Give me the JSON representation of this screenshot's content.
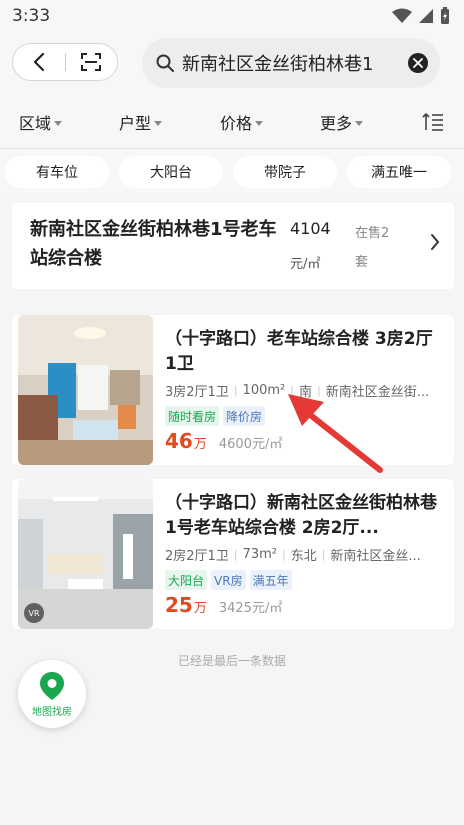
{
  "status_bar": {
    "time": "3:33"
  },
  "search": {
    "query": "新南社区金丝街柏林巷1"
  },
  "filters": [
    {
      "label": "区域"
    },
    {
      "label": "户型"
    },
    {
      "label": "价格"
    },
    {
      "label": "更多"
    }
  ],
  "tags": [
    "有车位",
    "大阳台",
    "带院子",
    "满五唯一"
  ],
  "community": {
    "name": "新南社区金丝街柏林巷1号老车站综合楼",
    "price_value": "4104",
    "price_unit": "元/㎡",
    "on_sale": "在售2套"
  },
  "listings": [
    {
      "title": "（十字路口）老车站综合楼 3房2厅1卫",
      "meta": [
        "3房2厅1卫",
        "100m²",
        "南",
        "新南社区金丝街..."
      ],
      "tags": [
        {
          "text": "随时看房",
          "style": "green"
        },
        {
          "text": "降价房",
          "style": "blue"
        }
      ],
      "price": "46",
      "price_unit": "万",
      "unit_price": "4600元/㎡"
    },
    {
      "title": "（十字路口）新南社区金丝街柏林巷1号老车站综合楼 2房2厅...",
      "meta": [
        "2房2厅1卫",
        "73m²",
        "东北",
        "新南社区金丝..."
      ],
      "tags": [
        {
          "text": "大阳台",
          "style": "green"
        },
        {
          "text": "VR房",
          "style": "blue"
        },
        {
          "text": "满五年",
          "style": "blue"
        }
      ],
      "price": "25",
      "price_unit": "万",
      "unit_price": "3425元/㎡",
      "vr_badge": "VR"
    }
  ],
  "end_text": "已经是最后一条数据",
  "map_button": {
    "label": "地图找房"
  },
  "colors": {
    "accent_green": "#1aa74f",
    "price_red": "#e04a1f",
    "arrow_red": "#e53935"
  }
}
